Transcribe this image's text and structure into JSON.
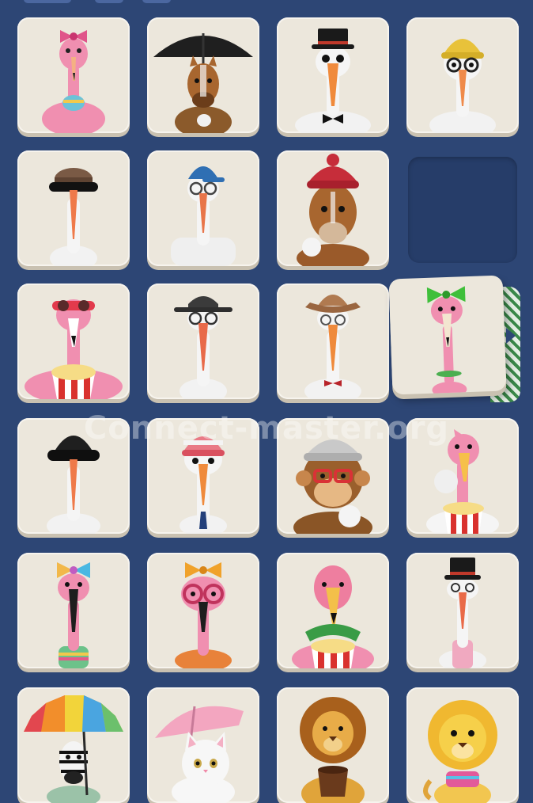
{
  "watermark": "Connect-master.org",
  "colors": {
    "background": "#2d4675",
    "tile": "#ece7dc",
    "tile_shadow": "#c9c1b1",
    "empty_slot": "#263d69"
  },
  "tiles": [
    {
      "id": "r1c1",
      "icon": "flamingo-bow-scarf-icon"
    },
    {
      "id": "r1c2",
      "icon": "horse-umbrella-icon"
    },
    {
      "id": "r1c3",
      "icon": "stork-top-hat-icon"
    },
    {
      "id": "r1c4",
      "icon": "stork-yellow-beanie-icon"
    },
    {
      "id": "r2c1",
      "icon": "stork-detective-cap-icon"
    },
    {
      "id": "r2c2",
      "icon": "stork-baseball-cap-icon"
    },
    {
      "id": "r2c3",
      "icon": "horse-red-beanie-icon"
    },
    {
      "id": "r2c4",
      "icon": "empty-slot"
    },
    {
      "id": "r3c1",
      "icon": "flamingo-popcorn-icon"
    },
    {
      "id": "r3c2",
      "icon": "stork-fedora-icon"
    },
    {
      "id": "r3c3",
      "icon": "stork-cowboy-hat-icon"
    },
    {
      "id": "r3c4",
      "icon": "flamingo-green-bow-icon"
    },
    {
      "id": "r4c1",
      "icon": "stork-black-beanie-icon"
    },
    {
      "id": "r4c2",
      "icon": "stork-bobble-hat-icon"
    },
    {
      "id": "r4c3",
      "icon": "monkey-beanie-icon"
    },
    {
      "id": "r4c4",
      "icon": "flamingo-popcorn-snowball-icon"
    },
    {
      "id": "r5c1",
      "icon": "flamingo-rainbow-bow-icon"
    },
    {
      "id": "r5c2",
      "icon": "flamingo-glasses-bow-icon"
    },
    {
      "id": "r5c3",
      "icon": "flamingo-popcorn-scarf-icon"
    },
    {
      "id": "r5c4",
      "icon": "stork-top-hat-vest-icon"
    },
    {
      "id": "r6c1",
      "icon": "zebra-rainbow-umbrella-icon"
    },
    {
      "id": "r6c2",
      "icon": "cat-pink-umbrella-icon"
    },
    {
      "id": "r6c3",
      "icon": "lion-cup-icon"
    },
    {
      "id": "r6c4",
      "icon": "lion-cub-icon"
    }
  ]
}
